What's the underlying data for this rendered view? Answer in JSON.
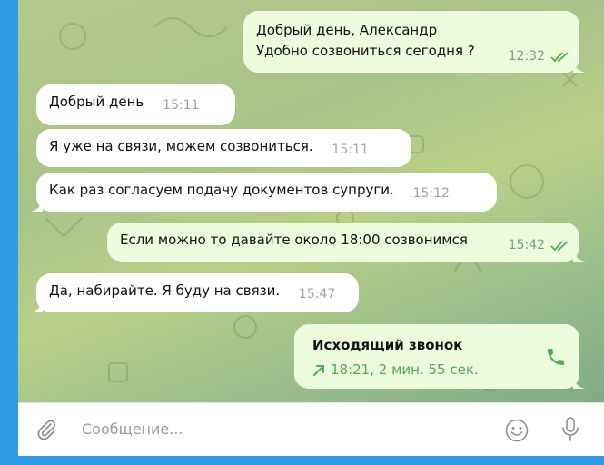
{
  "messages": [
    {
      "lines": [
        "Добрый день, Александр",
        "Удобно созвониться сегодня ?"
      ],
      "time": "12:32"
    },
    {
      "text": "Добрый день",
      "time": "15:11"
    },
    {
      "text": "Я уже на связи, можем созвониться.",
      "time": "15:11"
    },
    {
      "text": "Как раз согласуем подачу документов супруги.",
      "time": "15:12"
    },
    {
      "text": "Если можно то давайте около 18:00 созвонимся",
      "time": "15:42"
    },
    {
      "text": "Да, набирайте. Я буду на связи.",
      "time": "15:47"
    }
  ],
  "call": {
    "title": "Исходящий звонок",
    "details": "18:21, 2 мин. 55 сек."
  },
  "composer": {
    "placeholder": "Сообщение..."
  },
  "icons": {
    "attach": "paperclip-icon",
    "emoji": "emoji-icon",
    "mic": "microphone-icon",
    "phone": "phone-icon",
    "arrow": "outgoing-arrow-icon",
    "read": "double-check-icon"
  },
  "colors": {
    "outgoing_bubble": "#eefcde",
    "incoming_bubble": "#ffffff",
    "read_check": "#4caf50",
    "window_frame": "#2f9be6"
  }
}
